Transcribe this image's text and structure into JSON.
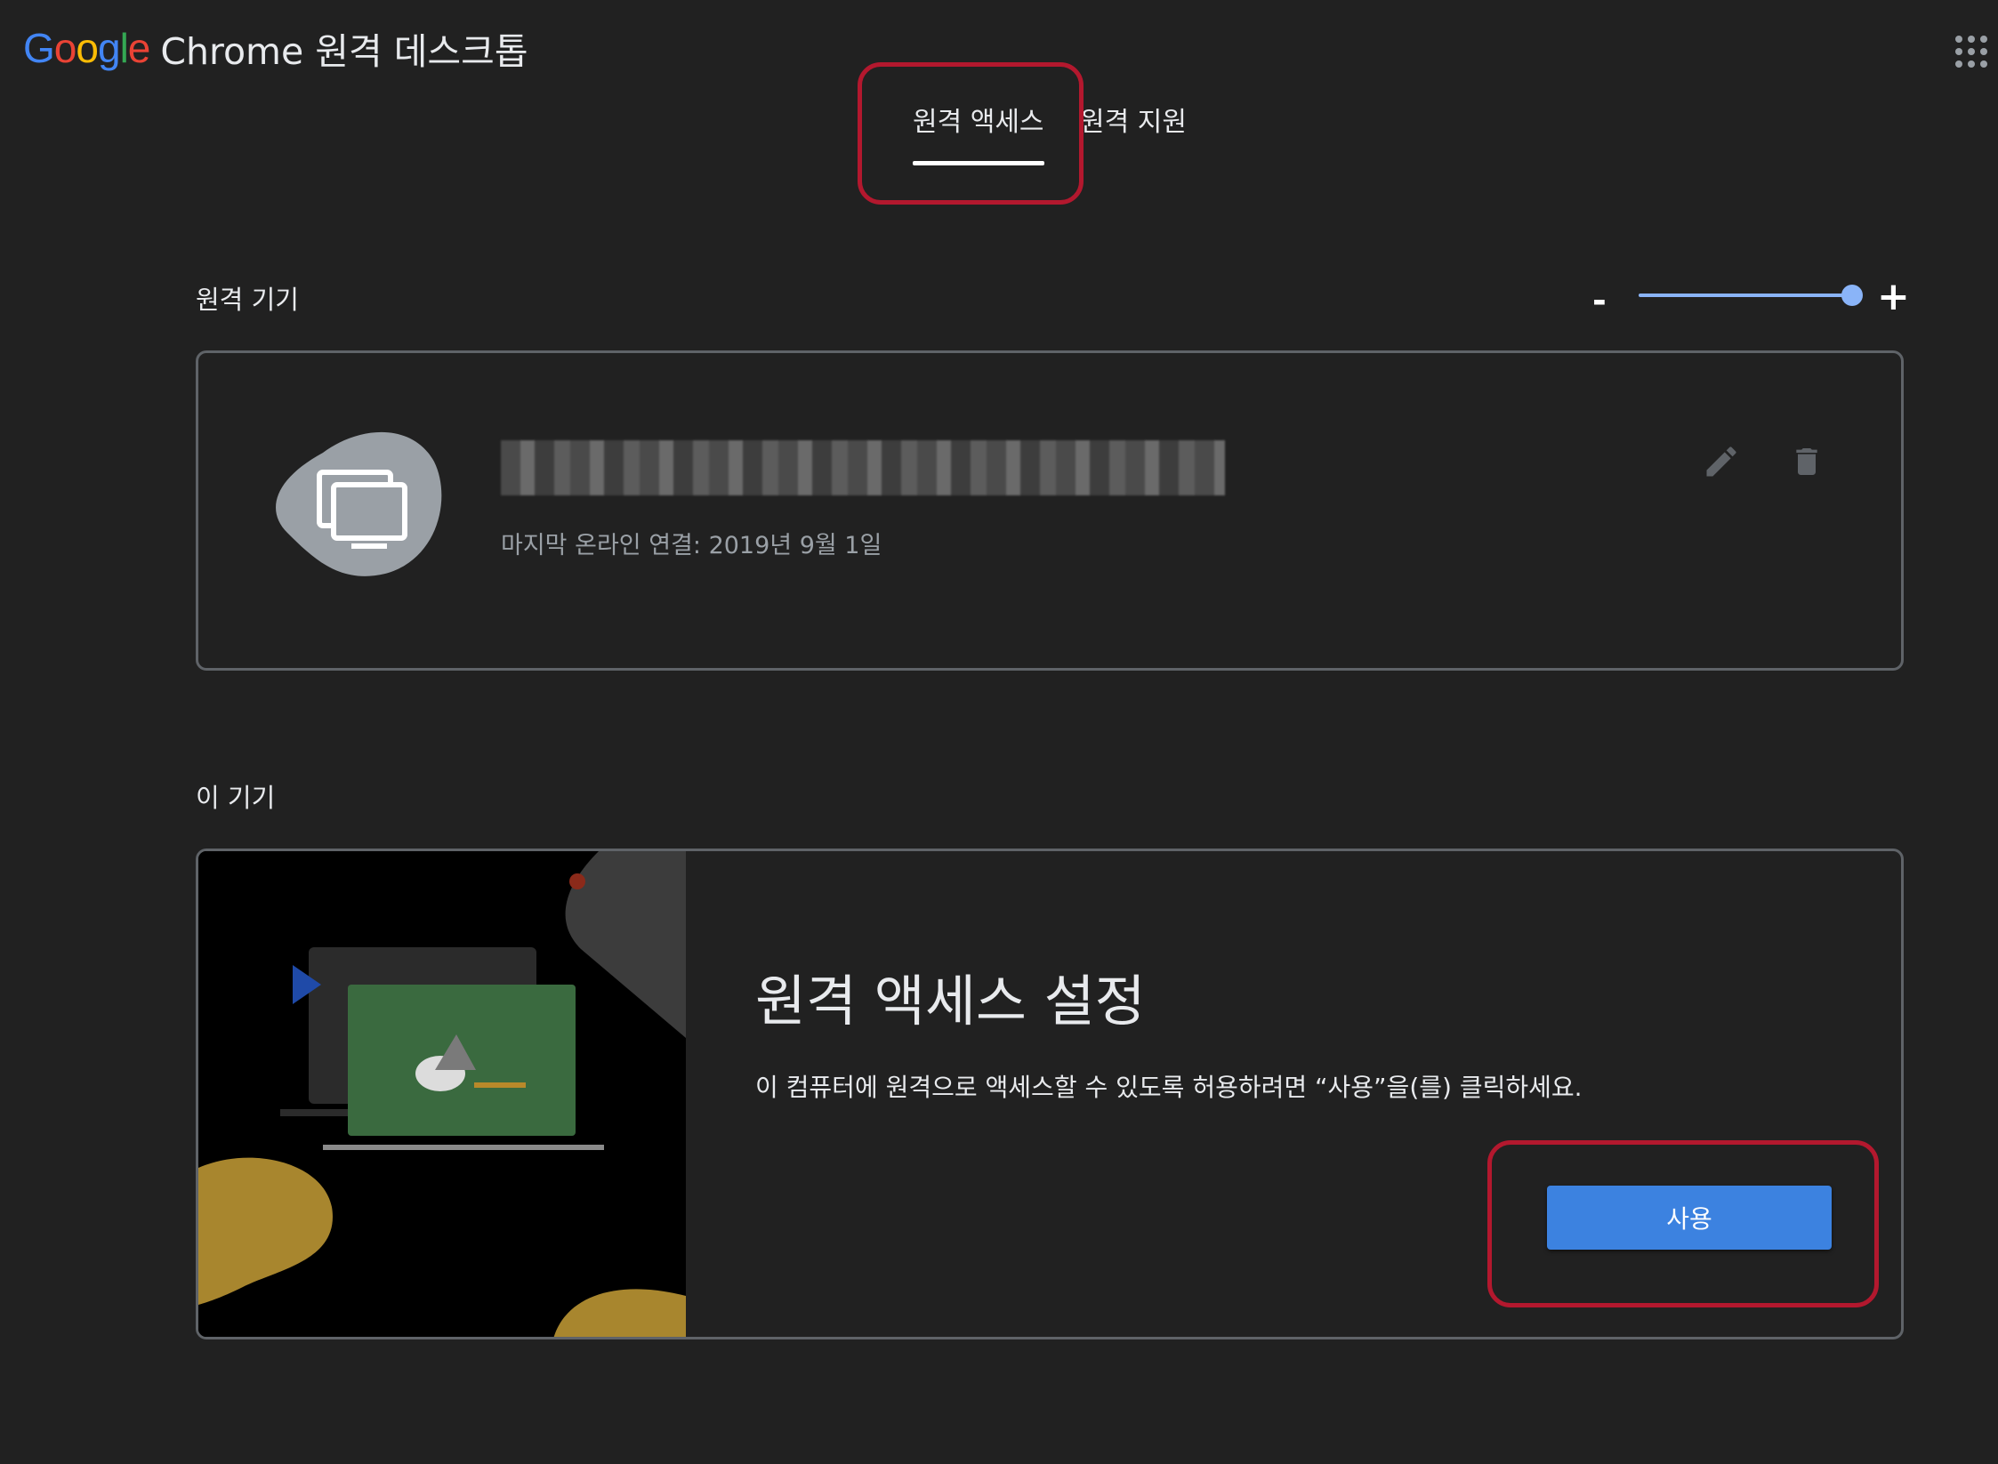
{
  "header": {
    "logo_text": "Google",
    "app_title": "Chrome 원격 데스크톱",
    "apps_icon": "apps-grid-icon"
  },
  "tabs": [
    {
      "label": "원격 액세스",
      "active": true
    },
    {
      "label": "원격 지원",
      "active": false
    }
  ],
  "remote_devices": {
    "section_label": "원격 기기",
    "zoom": {
      "minus": "-",
      "plus": "+",
      "value_fraction": 1.0
    },
    "devices": [
      {
        "name": "██████████████████",
        "name_redacted": true,
        "last_online": "마지막 온라인 연결: 2019년 9월 1일",
        "icons": [
          "computer-icon",
          "edit-icon",
          "delete-icon"
        ]
      }
    ]
  },
  "this_device": {
    "section_label": "이 기기",
    "setup_title": "원격 액세스 설정",
    "setup_description": "이 컴퓨터에 원격으로 액세스할 수 있도록 허용하려면 “사용”을(를) 클릭하세요.",
    "enable_button": "사용"
  },
  "colors": {
    "background": "#212121",
    "accent_blue": "#3c82e0",
    "slider": "#8ab4f8",
    "highlight_annotation": "#b3182e"
  }
}
